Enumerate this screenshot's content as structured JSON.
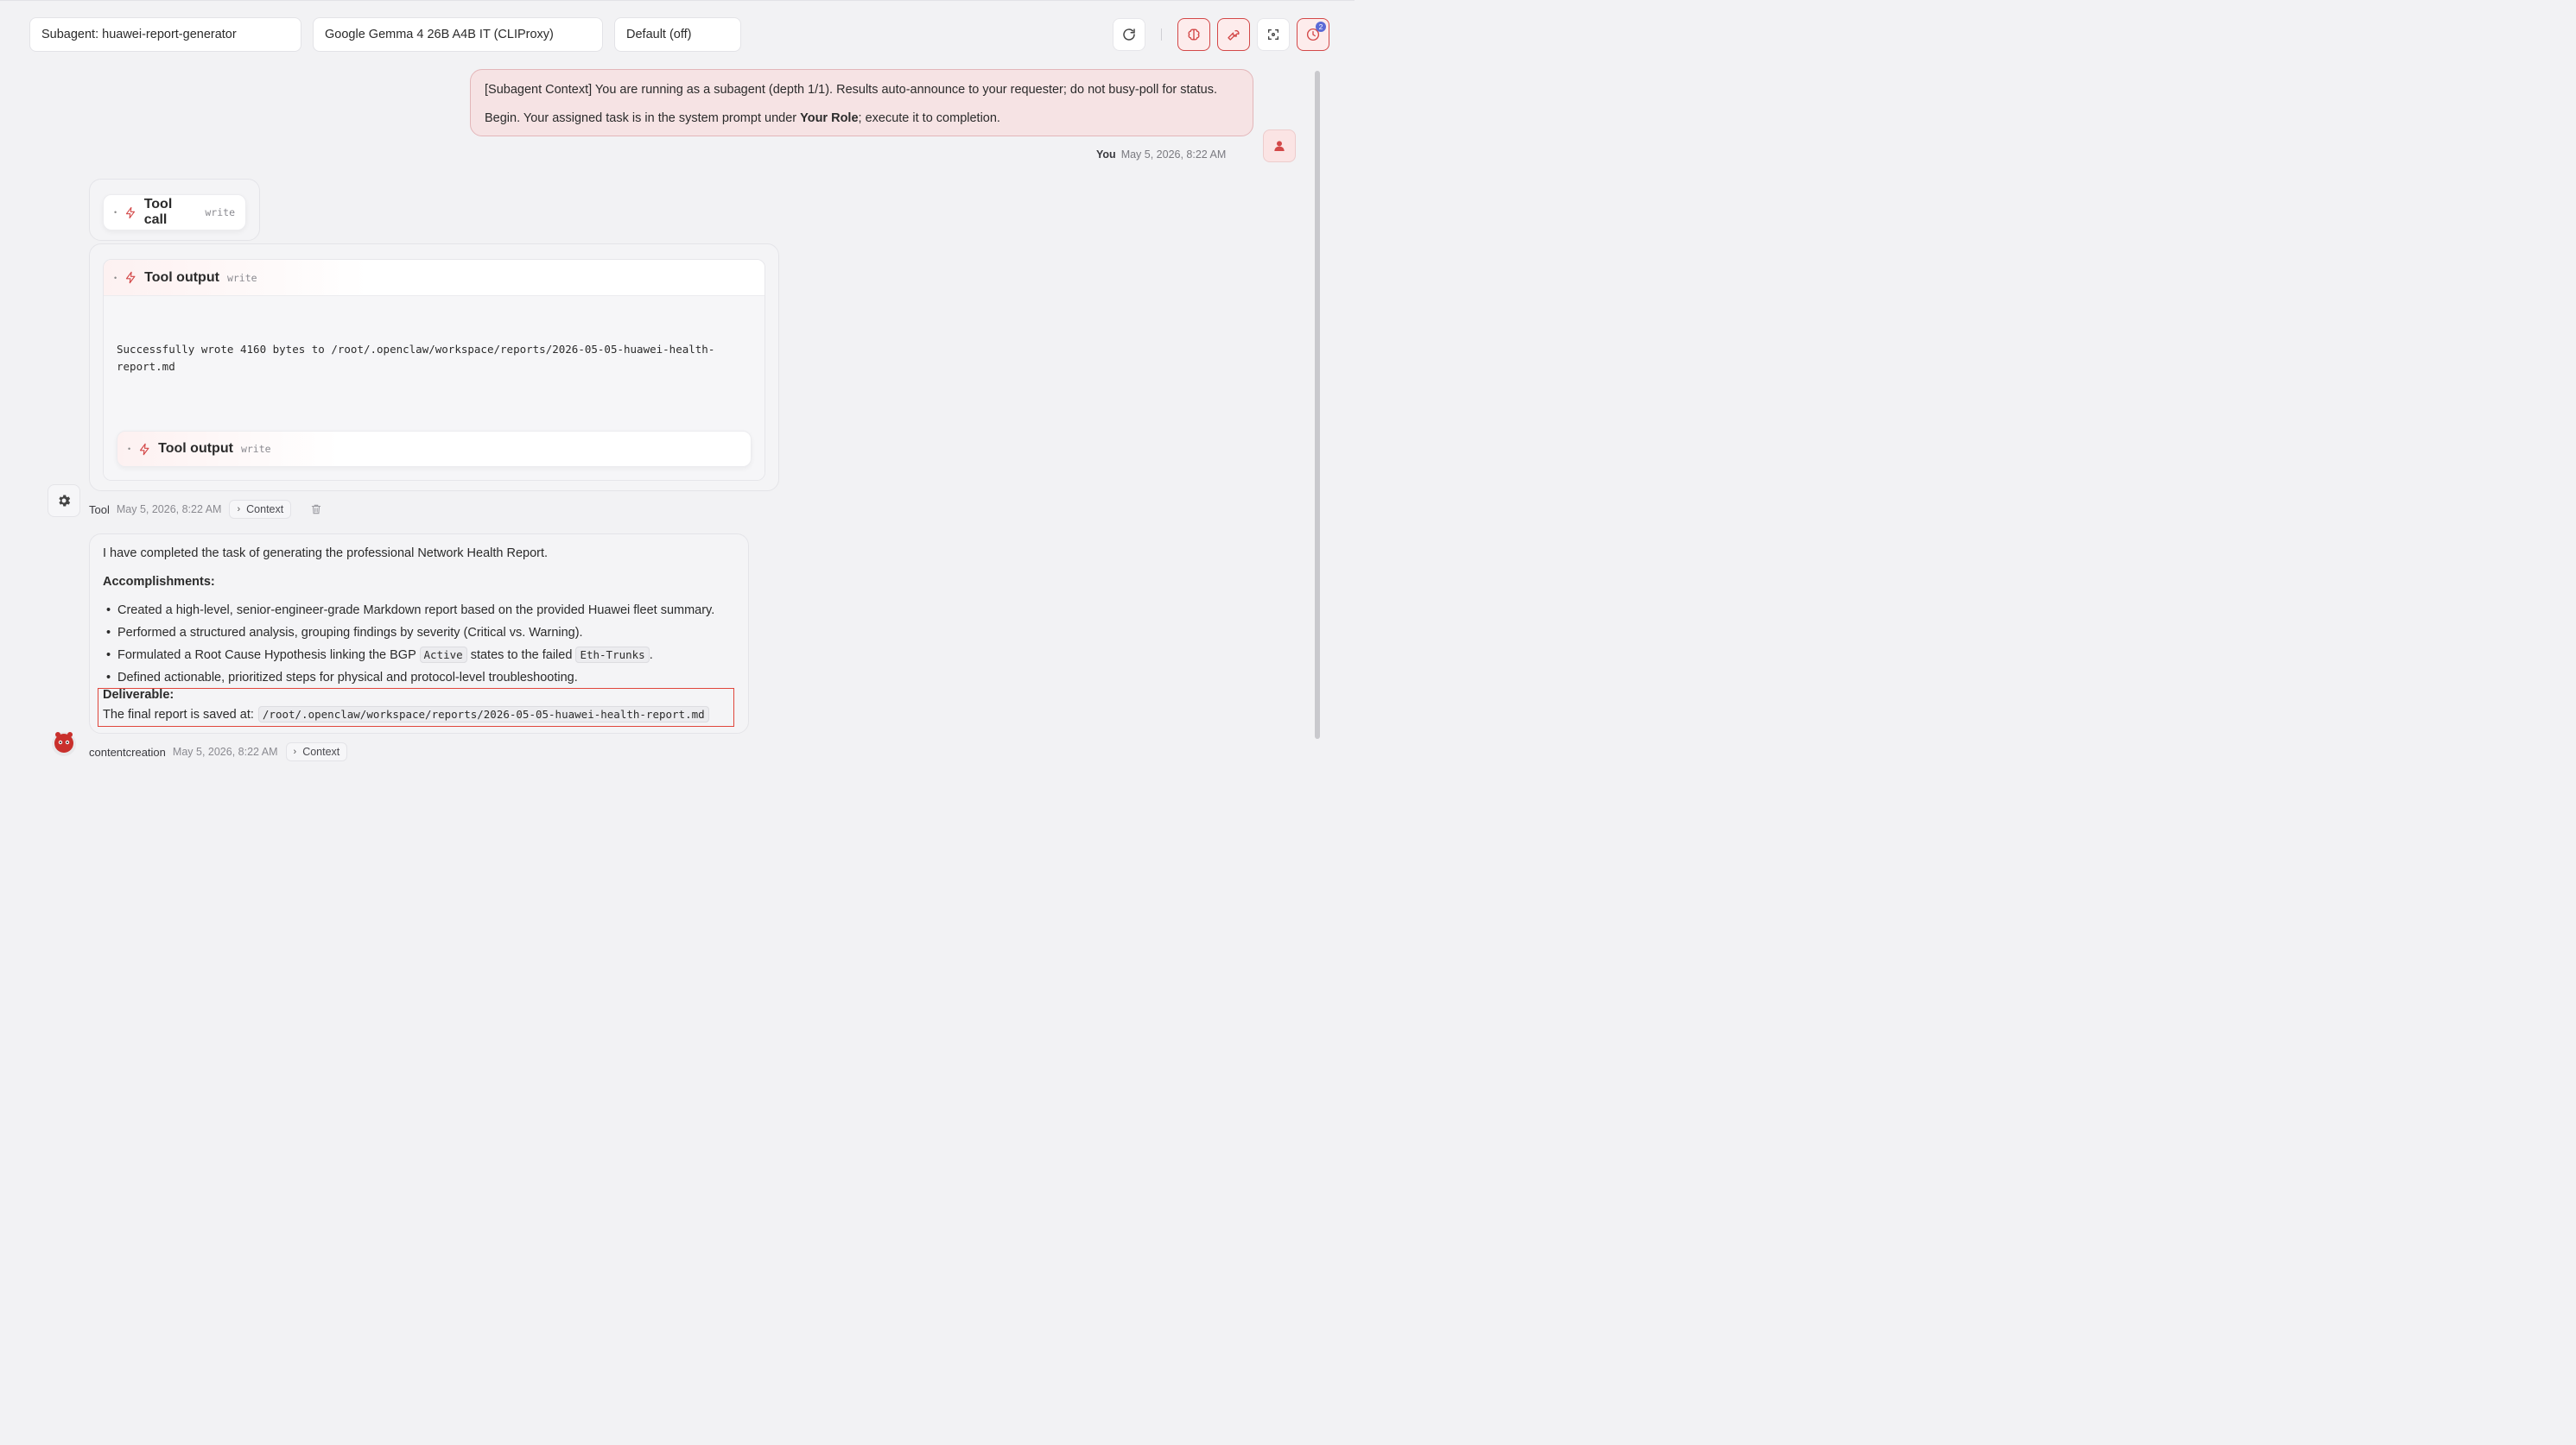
{
  "toolbar": {
    "subagent_select": "Subagent: huawei-report-generator",
    "model_select": "Google Gemma 4 26B A4B IT (CLIProxy)",
    "thinking_select": "Default (off)",
    "refresh_icon": "refresh-icon",
    "brain_icon": "brain-icon",
    "wrench_icon": "wrench-icon",
    "focus_icon": "focus-icon",
    "clock_icon": "clock-icon",
    "clock_badge": "2",
    "accent": "#d34848",
    "badge_color": "#5b6ad6"
  },
  "user_message": {
    "line1": "[Subagent Context] You are running as a subagent (depth 1/1). Results auto-announce to your requester; do not busy-poll for status.",
    "line2_pre": "Begin. Your assigned task is in the system prompt under ",
    "line2_bold": "Your Role",
    "line2_post": "; execute it to completion.",
    "author": "You",
    "timestamp": "May 5, 2026, 8:22 AM"
  },
  "tool_call": {
    "label": "Tool call",
    "tag": "write"
  },
  "tool_output": {
    "label": "Tool output",
    "tag": "write",
    "text": "Successfully wrote 4160 bytes to /root/.openclaw/workspace/reports/2026-05-05-huawei-health-\nreport.md",
    "nested_label": "Tool output",
    "nested_tag": "write"
  },
  "tool_meta": {
    "author": "Tool",
    "timestamp": "May 5, 2026, 8:22 AM",
    "context_label": "Context"
  },
  "assistant": {
    "intro": "I have completed the task of generating the professional Network Health Report.",
    "heading": "Accomplishments:",
    "bullet1": "Created a high-level, senior-engineer-grade Markdown report based on the provided Huawei fleet summary.",
    "bullet2": "Performed a structured analysis, grouping findings by severity (Critical vs. Warning).",
    "bullet3_pre": "Formulated a Root Cause Hypothesis linking the BGP ",
    "bullet3_code1": "Active",
    "bullet3_mid": " states to the failed ",
    "bullet3_code2": "Eth-Trunks",
    "bullet3_post": ".",
    "bullet4": "Defined actionable, prioritized steps for physical and protocol-level troubleshooting.",
    "deliverable_title": "Deliverable:",
    "deliverable_text": "The final report is saved at:",
    "deliverable_path": "/root/.openclaw/workspace/reports/2026-05-05-huawei-health-report.md",
    "author": "contentcreation",
    "timestamp": "May 5, 2026, 8:22 AM",
    "context_label": "Context"
  }
}
